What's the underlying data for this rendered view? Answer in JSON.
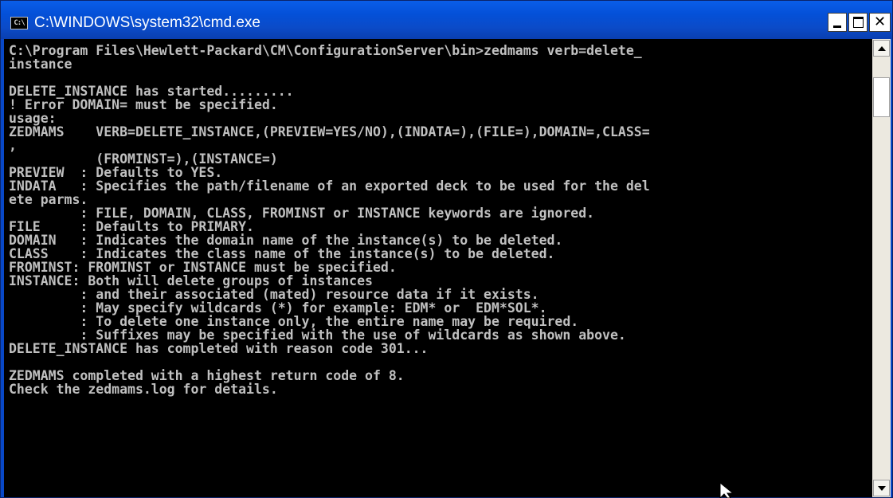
{
  "window": {
    "title": "C:\\WINDOWS\\system32\\cmd.exe",
    "icon_label": "C:\\",
    "icon": "cmd-icon",
    "controls": [
      "minimize-icon",
      "maximize-icon",
      "close-icon"
    ]
  },
  "console": {
    "lines": [
      "C:\\Program Files\\Hewlett-Packard\\CM\\ConfigurationServer\\bin>zedmams verb=delete_",
      "instance",
      "",
      "DELETE_INSTANCE has started.........",
      "! Error DOMAIN= must be specified.",
      "usage:",
      "ZEDMAMS    VERB=DELETE_INSTANCE,(PREVIEW=YES/NO),(INDATA=),(FILE=),DOMAIN=,CLASS=",
      ",",
      "           (FROMINST=),(INSTANCE=)",
      "PREVIEW  : Defaults to YES.",
      "INDATA   : Specifies the path/filename of an exported deck to be used for the del",
      "ete parms.",
      "         : FILE, DOMAIN, CLASS, FROMINST or INSTANCE keywords are ignored.",
      "FILE     : Defaults to PRIMARY.",
      "DOMAIN   : Indicates the domain name of the instance(s) to be deleted.",
      "CLASS    : Indicates the class name of the instance(s) to be deleted.",
      "FROMINST: FROMINST or INSTANCE must be specified.",
      "INSTANCE: Both will delete groups of instances",
      "         : and their associated (mated) resource data if it exists.",
      "         : May specify wildcards (*) for example: EDM* or  EDM*SOL*.",
      "         : To delete one instance only, the entire name may be required.",
      "         : Suffixes may be specified with the use of wildcards as shown above.",
      "DELETE_INSTANCE has completed with reason code 301...",
      "",
      "ZEDMAMS completed with a highest return code of 8.",
      "Check the zedmams.log for details."
    ]
  },
  "colors": {
    "titlebar": "#0a5ee8",
    "console_bg": "#000000",
    "console_text": "#c0c0c0",
    "scrollbar": "#ece9e0"
  }
}
